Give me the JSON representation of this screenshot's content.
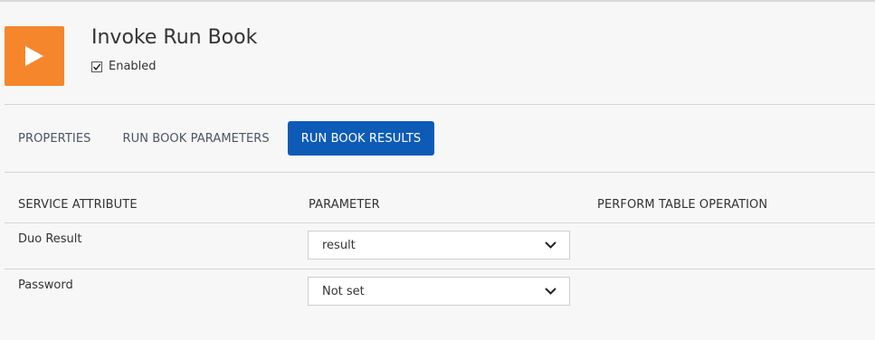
{
  "header": {
    "title": "Invoke Run Book",
    "enabled_label": "Enabled",
    "enabled_checked": true,
    "icon": "play-icon",
    "accent_color": "#f5862b"
  },
  "tabs": [
    {
      "label": "PROPERTIES",
      "active": false
    },
    {
      "label": "RUN BOOK PARAMETERS",
      "active": false
    },
    {
      "label": "RUN BOOK RESULTS",
      "active": true
    }
  ],
  "active_tab_color": "#0d5bb6",
  "table": {
    "columns": [
      "SERVICE ATTRIBUTE",
      "PARAMETER",
      "PERFORM TABLE OPERATION"
    ],
    "rows": [
      {
        "attribute": "Duo Result",
        "parameter": "result"
      },
      {
        "attribute": "Password",
        "parameter": "Not set"
      }
    ]
  }
}
